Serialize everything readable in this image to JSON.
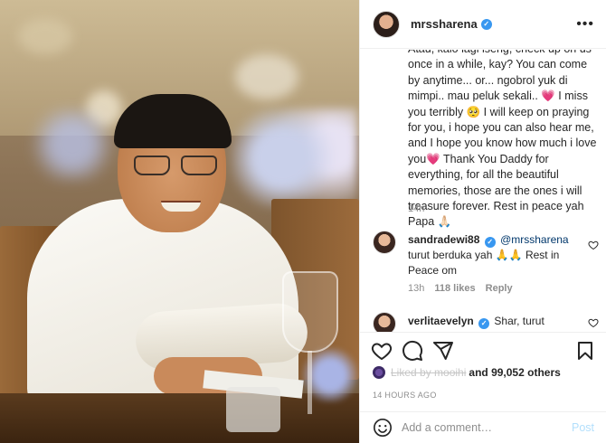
{
  "post": {
    "username": "mrssharena",
    "verified_badge": "verified-badge-icon",
    "more_icon": "ellipsis-icon",
    "caption": "Atau, kalo lagi iseng, check up on us once in a while, kay? You can come by anytime... or... ngobrol yuk di mimpi.. mau peluk sekali.. 💗 I miss you terribly 🥺 I will keep on praying for you, i hope you can also hear me, and I hope you know how much i love you💗 Thank You Daddy for everything, for all the beautiful memories, those are the ones i will treasure forever. Rest in peace yah Papa 🙏🏻",
    "caption_time": "14h"
  },
  "comments": [
    {
      "username": "sandradewi88",
      "verified": true,
      "mention": "@mrssharena",
      "text": "turut berduka yah 🙏🙏 Rest in Peace om",
      "time": "13h",
      "likes": "118 likes",
      "reply": "Reply"
    },
    {
      "username": "verlitaevelyn",
      "verified": true,
      "text": "Shar, turut"
    }
  ],
  "actions": {
    "like_icon": "heart-icon",
    "comment_icon": "comment-icon",
    "share_icon": "share-icon",
    "save_icon": "bookmark-icon"
  },
  "likes": {
    "liked_by": "Liked by",
    "liked_by_name": "mooihi",
    "others": "and 99,052 others"
  },
  "post_date": "14 HOURS AGO",
  "comment_box": {
    "placeholder": "Add a comment…",
    "post_label": "Post",
    "emoji_icon": "smiley-icon"
  },
  "colors": {
    "link": "#00376b",
    "verified": "#3897f0",
    "muted": "#8e8e8e",
    "post_button": "#b2dffc"
  }
}
